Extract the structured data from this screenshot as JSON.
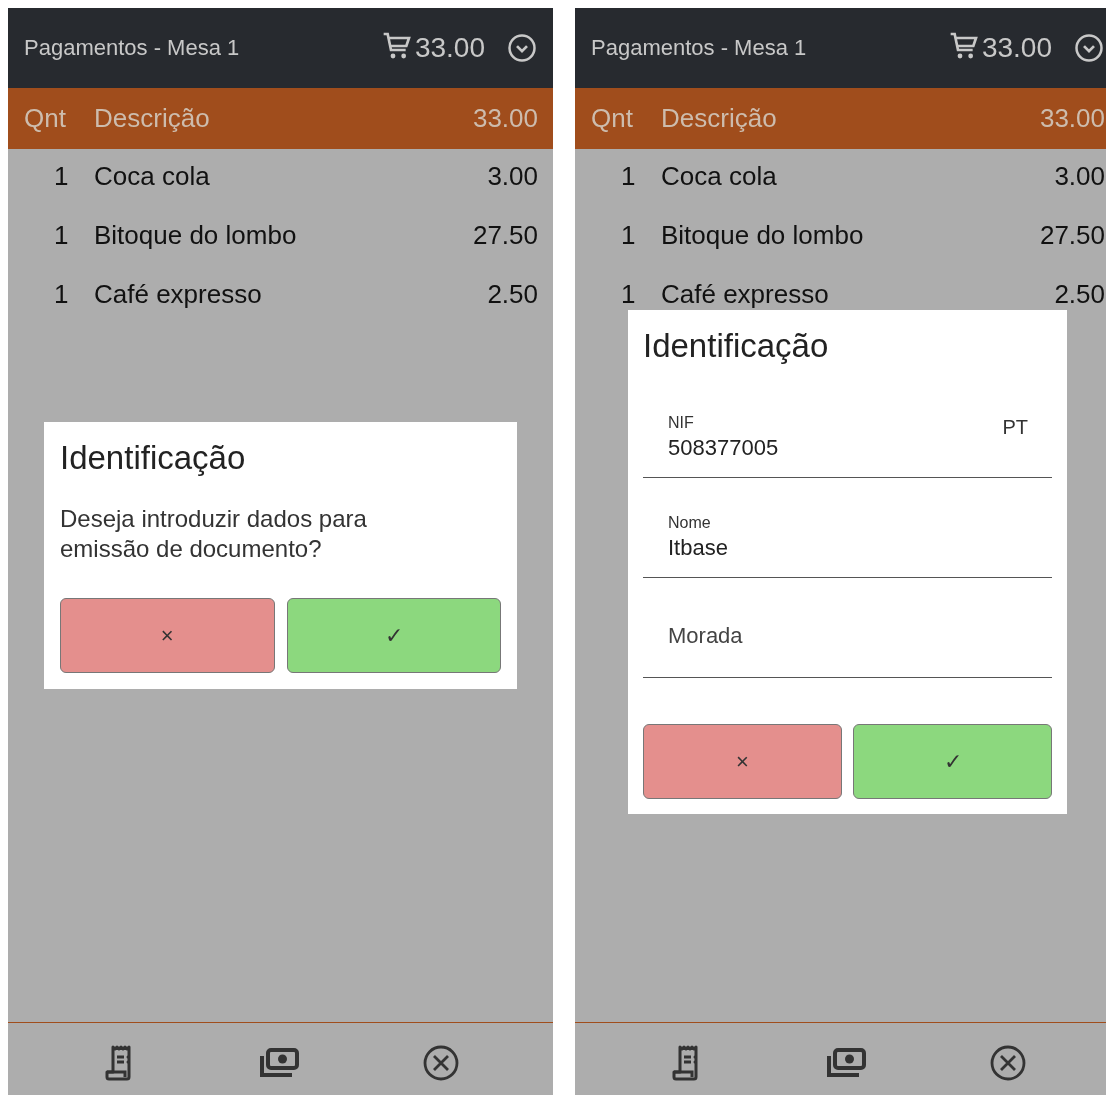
{
  "screens": [
    {
      "header": {
        "title": "Pagamentos - Mesa 1",
        "total": "33.00"
      },
      "columns": {
        "quantity": "Qnt",
        "description": "Descrição",
        "total": "33.00"
      },
      "rows": [
        {
          "quantity": "1",
          "description": "Coca cola",
          "price": "3.00"
        },
        {
          "quantity": "1",
          "description": "Bitoque do lombo",
          "price": "27.50"
        },
        {
          "quantity": "1",
          "description": "Café expresso",
          "price": "2.50"
        }
      ],
      "dialog": {
        "kind": "confirm",
        "title": "Identificação",
        "message": "Deseja introduzir dados para emissão de documento?",
        "buttons": [
          {
            "kind": "cancel",
            "label": "×"
          },
          {
            "kind": "ok",
            "label": "✓"
          }
        ]
      }
    },
    {
      "header": {
        "title": "Pagamentos - Mesa 1",
        "total": "33.00"
      },
      "columns": {
        "quantity": "Qnt",
        "description": "Descrição",
        "total": "33.00"
      },
      "rows": [
        {
          "quantity": "1",
          "description": "Coca cola",
          "price": "3.00"
        },
        {
          "quantity": "1",
          "description": "Bitoque do lombo",
          "price": "27.50"
        },
        {
          "quantity": "1",
          "description": "Café expresso",
          "price": "2.50"
        }
      ],
      "dialog": {
        "kind": "form",
        "title": "Identificação",
        "fields": [
          {
            "label": "NIF",
            "value": "508377005",
            "suffix": "PT"
          },
          {
            "label": "Nome",
            "value": "Itbase"
          },
          {
            "placeholder": "Morada"
          }
        ],
        "buttons": [
          {
            "kind": "cancel",
            "label": "×"
          },
          {
            "kind": "ok",
            "label": "✓"
          }
        ]
      }
    }
  ]
}
